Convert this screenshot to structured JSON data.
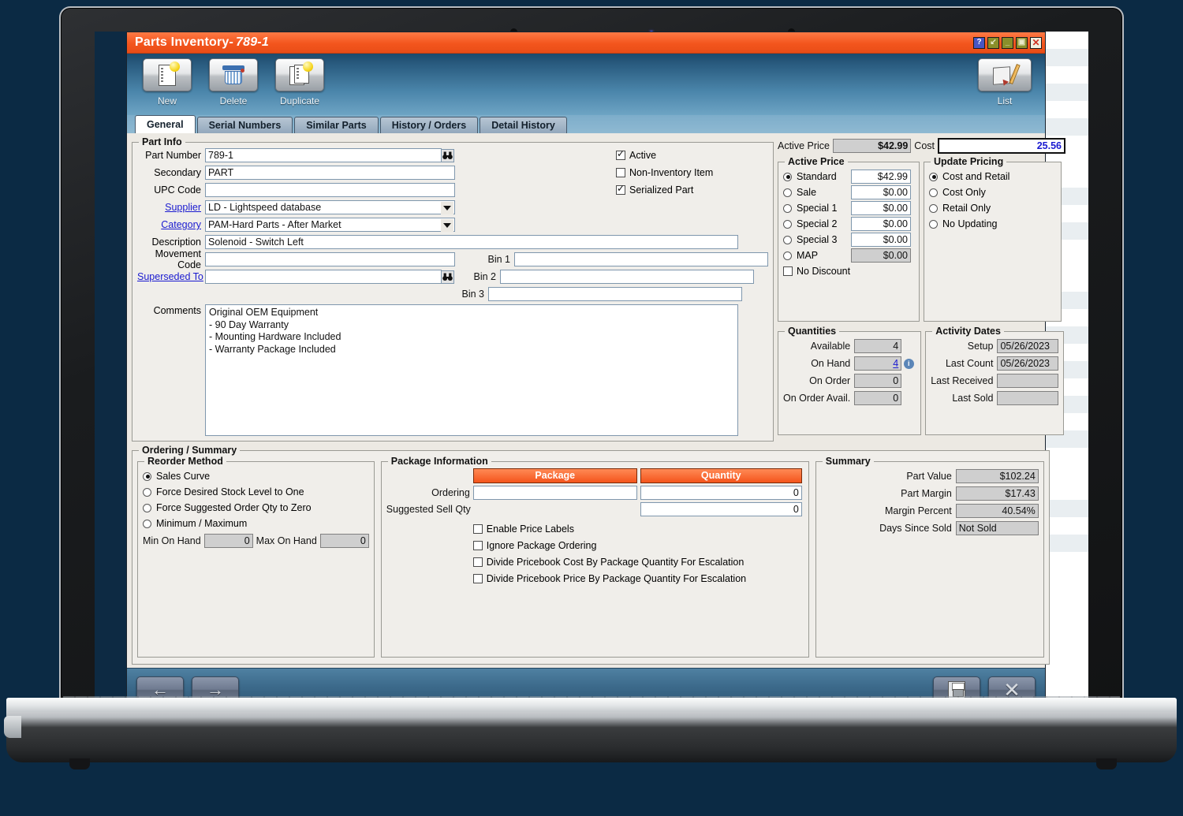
{
  "window": {
    "title_main": "Parts Inventory-",
    "title_id": "789-1",
    "buttons": {
      "help": "?",
      "restore": "↙",
      "minimize": "_",
      "maximize": "▣",
      "close": "✕"
    }
  },
  "toolbar": {
    "new_label": "New",
    "delete_label": "Delete",
    "duplicate_label": "Duplicate",
    "list_label": "List"
  },
  "tabs": [
    {
      "label": "General",
      "active": true
    },
    {
      "label": "Serial Numbers",
      "active": false
    },
    {
      "label": "Similar Parts",
      "active": false
    },
    {
      "label": "History / Orders",
      "active": false
    },
    {
      "label": "Detail History",
      "active": false
    }
  ],
  "part_info": {
    "legend": "Part Info",
    "part_number_label": "Part Number",
    "part_number_value": "789-1",
    "secondary_label": "Secondary",
    "secondary_value": "PART",
    "upc_label": "UPC Code",
    "upc_value": "",
    "supplier_label": "Supplier",
    "supplier_value": "LD - Lightspeed database",
    "category_label": "Category",
    "category_value": "PAM-Hard Parts - After Market",
    "description_label": "Description",
    "description_value": "Solenoid - Switch Left",
    "movement_label": "Movement Code",
    "movement_value": "",
    "superseded_label": "Superseded To",
    "superseded_value": "",
    "comments_label": "Comments",
    "comments_value": "Original OEM Equipment\n- 90 Day Warranty\n- Mounting Hardware Included\n- Warranty Package Included",
    "checkboxes": [
      {
        "label": "Active",
        "checked": true
      },
      {
        "label": "Non-Inventory Item",
        "checked": false
      },
      {
        "label": "Serialized Part",
        "checked": true
      }
    ],
    "bins": [
      {
        "label": "Bin 1",
        "value": ""
      },
      {
        "label": "Bin 2",
        "value": ""
      },
      {
        "label": "Bin 3",
        "value": ""
      }
    ]
  },
  "pricing_header": {
    "active_price_label": "Active Price",
    "active_price_value": "$42.99",
    "cost_label": "Cost",
    "cost_value": "25.56"
  },
  "active_price": {
    "legend": "Active Price",
    "rows": [
      {
        "label": "Standard",
        "value": "$42.99",
        "selected": true,
        "readonly": false
      },
      {
        "label": "Sale",
        "value": "$0.00",
        "selected": false,
        "readonly": false
      },
      {
        "label": "Special 1",
        "value": "$0.00",
        "selected": false,
        "readonly": false
      },
      {
        "label": "Special 2",
        "value": "$0.00",
        "selected": false,
        "readonly": false
      },
      {
        "label": "Special 3",
        "value": "$0.00",
        "selected": false,
        "readonly": false
      },
      {
        "label": "MAP",
        "value": "$0.00",
        "selected": false,
        "readonly": true
      }
    ],
    "no_discount_label": "No Discount",
    "no_discount_checked": false
  },
  "update_pricing": {
    "legend": "Update Pricing",
    "options": [
      {
        "label": "Cost and Retail",
        "selected": true
      },
      {
        "label": "Cost Only",
        "selected": false
      },
      {
        "label": "Retail Only",
        "selected": false
      },
      {
        "label": "No Updating",
        "selected": false
      }
    ]
  },
  "quantities": {
    "legend": "Quantities",
    "rows": [
      {
        "label": "Available",
        "value": "4",
        "link": false,
        "info": false
      },
      {
        "label": "On Hand",
        "value": "4",
        "link": true,
        "info": true
      },
      {
        "label": "On Order",
        "value": "0",
        "link": false,
        "info": false
      },
      {
        "label": "On Order Avail.",
        "value": "0",
        "link": false,
        "info": false
      }
    ]
  },
  "activity_dates": {
    "legend": "Activity Dates",
    "rows": [
      {
        "label": "Setup",
        "value": "05/26/2023"
      },
      {
        "label": "Last Count",
        "value": "05/26/2023"
      },
      {
        "label": "Last Received",
        "value": ""
      },
      {
        "label": "Last Sold",
        "value": ""
      }
    ]
  },
  "ordering_summary": {
    "legend": "Ordering / Summary",
    "reorder_method": {
      "legend": "Reorder Method",
      "options": [
        {
          "label": "Sales Curve",
          "selected": true
        },
        {
          "label": "Force Desired Stock Level to One",
          "selected": false
        },
        {
          "label": "Force Suggested Order Qty to Zero",
          "selected": false
        },
        {
          "label": "Minimum / Maximum",
          "selected": false
        }
      ],
      "min_label": "Min On Hand",
      "min_value": "0",
      "max_label": "Max On Hand",
      "max_value": "0"
    },
    "package_information": {
      "legend": "Package Information",
      "col_package": "Package",
      "col_quantity": "Quantity",
      "ordering_label": "Ordering",
      "ordering_package": "",
      "ordering_quantity": "0",
      "suggested_label": "Suggested Sell Qty",
      "suggested_quantity": "0",
      "checkboxes": [
        {
          "label": "Enable Price Labels",
          "checked": false
        },
        {
          "label": "Ignore Package Ordering",
          "checked": false
        },
        {
          "label": "Divide Pricebook Cost By Package Quantity For Escalation",
          "checked": false
        },
        {
          "label": "Divide Pricebook Price By Package Quantity For Escalation",
          "checked": false
        }
      ]
    },
    "summary": {
      "legend": "Summary",
      "rows": [
        {
          "label": "Part Value",
          "value": "$102.24"
        },
        {
          "label": "Part Margin",
          "value": "$17.43"
        },
        {
          "label": "Margin Percent",
          "value": "40.54%"
        },
        {
          "label": "Days Since Sold",
          "value": "Not Sold"
        }
      ]
    }
  },
  "footer": {
    "prev_icon": "←",
    "next_icon": "→",
    "save_icon": "save-floppy",
    "cancel_icon": "✕"
  },
  "colors": {
    "accent_orange": "#f4541c",
    "title_blue": "#2a5c80",
    "desktop_navy": "#0b2a44"
  }
}
